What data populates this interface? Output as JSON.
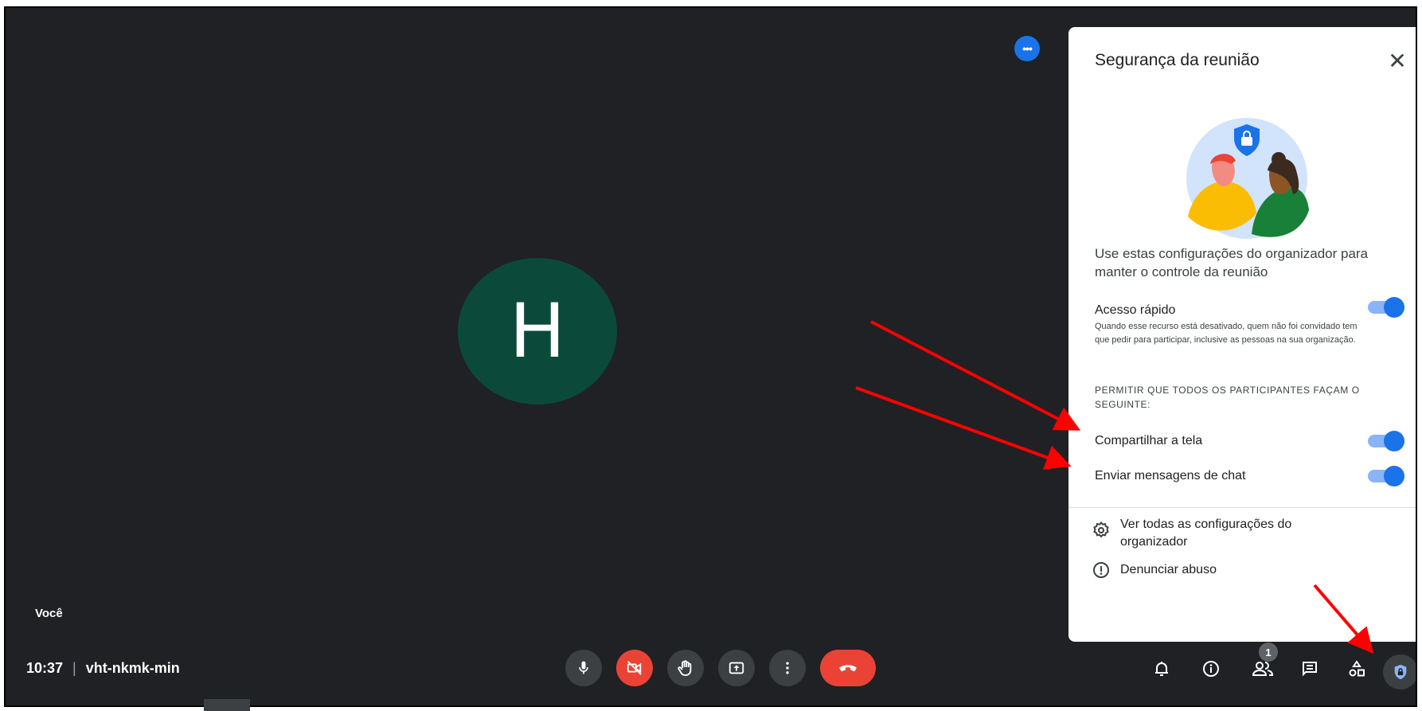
{
  "participant": {
    "initial": "H",
    "self_label": "Você",
    "avatar_color": "#0b4a3a"
  },
  "meeting": {
    "time": "10:37",
    "separator": "|",
    "code": "vht-nkmk-min"
  },
  "more_options": {
    "glyph": "•••"
  },
  "controls": {
    "mic": "microphone-icon",
    "camera": "camera-off-icon",
    "hand": "raise-hand-icon",
    "present": "present-screen-icon",
    "more": "more-vert-icon",
    "end_call": "end-call-icon"
  },
  "right_controls": {
    "participants_count": "1"
  },
  "panel": {
    "title": "Segurança da reunião",
    "close": "✕",
    "intro": "Use estas configurações do organizador para manter o controle da reunião",
    "quick_access": {
      "label": "Acesso rápido",
      "description": "Quando esse recurso está desativado, quem não foi convidado tem que pedir para participar, inclusive as pessoas na sua organização.",
      "enabled": true
    },
    "allow_caption": "PERMITIR QUE TODOS OS PARTICIPANTES FAÇAM O SEGUINTE:",
    "share_screen": {
      "label": "Compartilhar a tela",
      "enabled": true
    },
    "chat": {
      "label": "Enviar mensagens de chat",
      "enabled": true
    },
    "view_all": "Ver todas as configurações do organizador",
    "report": "Denunciar abuso"
  },
  "colors": {
    "background": "#202124",
    "accent": "#1a73e8",
    "danger": "#ea4335",
    "arrow": "#ff0000"
  }
}
